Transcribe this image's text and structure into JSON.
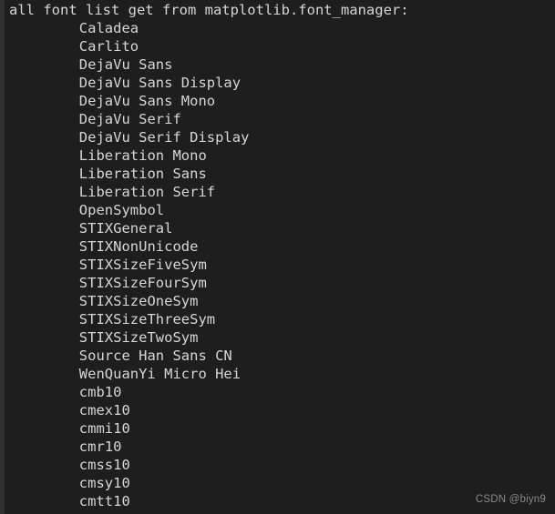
{
  "terminal": {
    "background_color": "#1e1e1e",
    "gutter_color": "#2f2f2f",
    "text_color": "#d6d6d6",
    "clipped_top_line": "",
    "header_line": "all font list get from matplotlib.font_manager:",
    "indent": "        ",
    "font_list": [
      "Caladea",
      "Carlito",
      "DejaVu Sans",
      "DejaVu Sans Display",
      "DejaVu Sans Mono",
      "DejaVu Serif",
      "DejaVu Serif Display",
      "Liberation Mono",
      "Liberation Sans",
      "Liberation Serif",
      "OpenSymbol",
      "STIXGeneral",
      "STIXNonUnicode",
      "STIXSizeFiveSym",
      "STIXSizeFourSym",
      "STIXSizeOneSym",
      "STIXSizeThreeSym",
      "STIXSizeTwoSym",
      "Source Han Sans CN",
      "WenQuanYi Micro Hei",
      "cmb10",
      "cmex10",
      "cmmi10",
      "cmr10",
      "cmss10",
      "cmsy10",
      "cmtt10"
    ]
  },
  "watermark": {
    "text": "CSDN @biyn9",
    "color": "#8a8a8a"
  }
}
